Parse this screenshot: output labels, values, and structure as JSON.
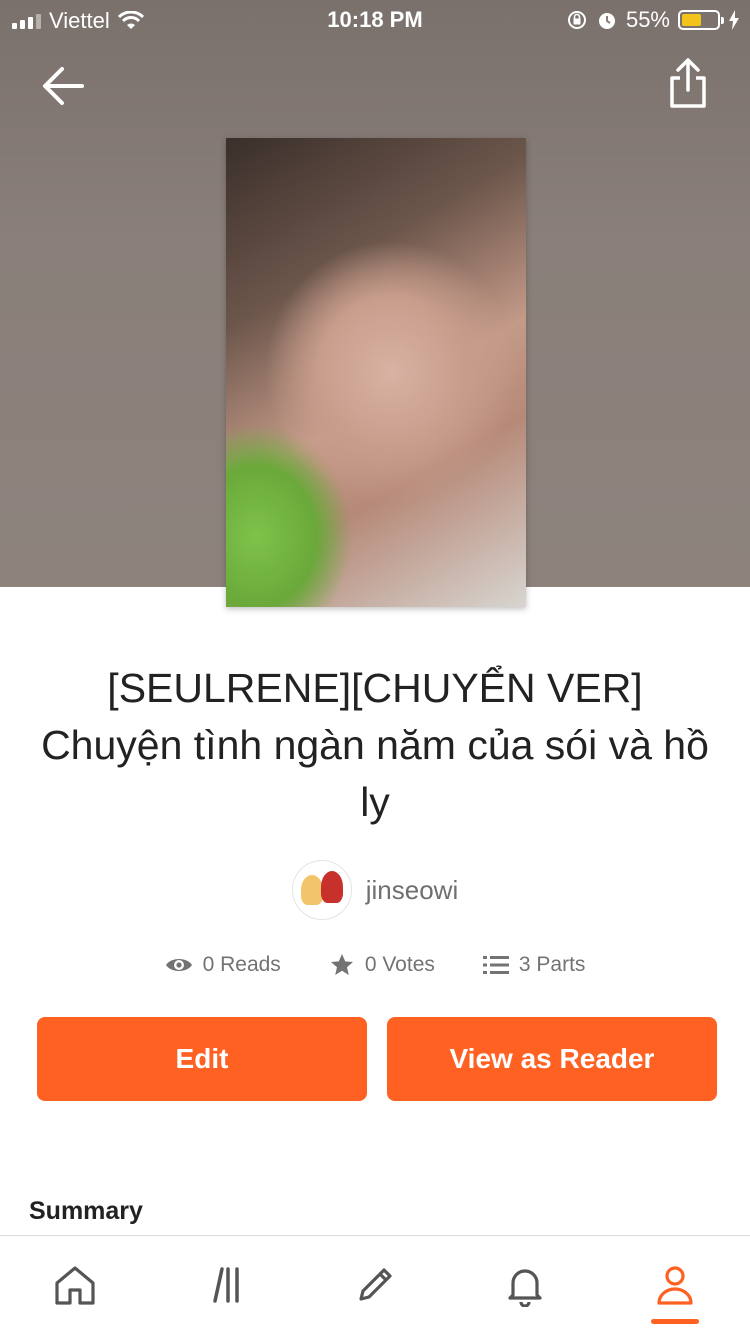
{
  "status_bar": {
    "carrier": "Viettel",
    "time": "10:18 PM",
    "battery_percent": "55%",
    "battery_level": 0.55
  },
  "header": {
    "back_icon": "arrow-left-icon",
    "share_icon": "share-icon"
  },
  "story": {
    "title": "[SEULRENE][CHUYỂN VER] Chuyện tình ngàn năm của sói và hồ ly",
    "author": "jinseowi",
    "reads": "0 Reads",
    "votes": "0 Votes",
    "parts": "3 Parts"
  },
  "actions": {
    "edit_label": "Edit",
    "reader_label": "View as Reader"
  },
  "sections": {
    "summary_label": "Summary"
  },
  "tabbar": {
    "items": [
      "home",
      "library",
      "write",
      "notifications",
      "profile"
    ],
    "active": "profile"
  },
  "colors": {
    "accent": "#ff6122",
    "text": "#222222",
    "muted": "#737373"
  }
}
